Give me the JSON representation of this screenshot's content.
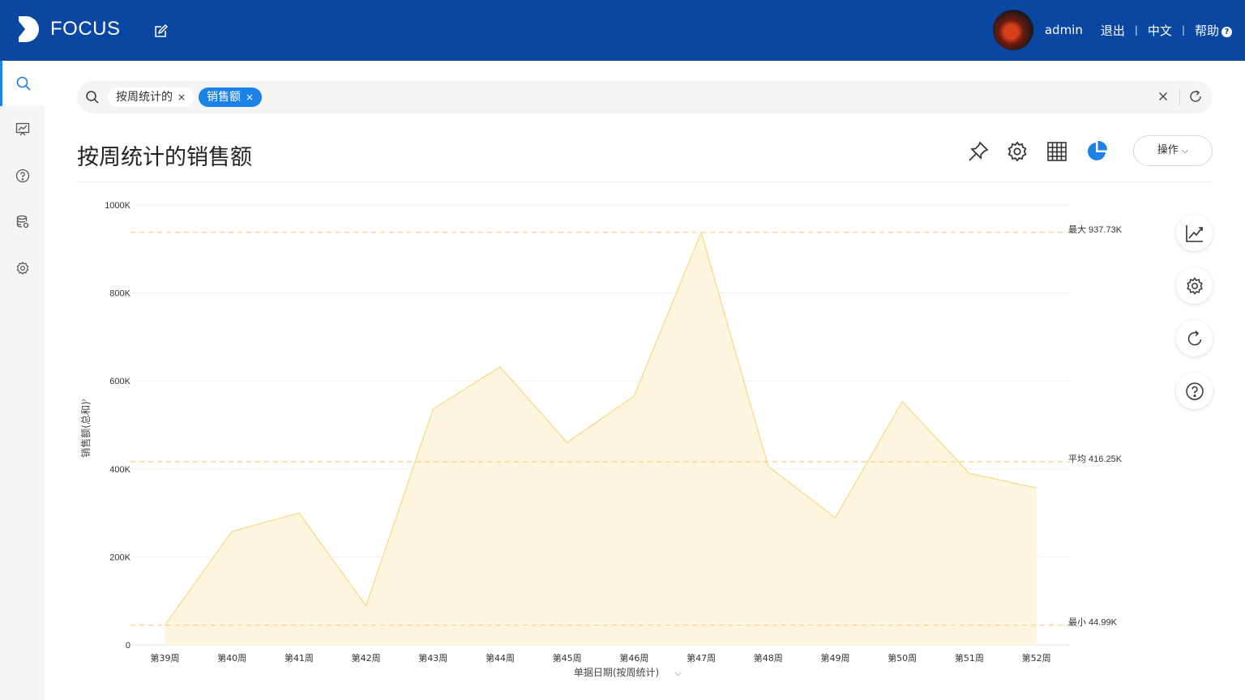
{
  "app": {
    "logo_text": "FOCUS"
  },
  "user": {
    "name": "admin",
    "logout": "退出",
    "language": "中文",
    "help": "帮助",
    "help_mark": "?"
  },
  "search": {
    "tokens": [
      {
        "label": "按周统计的",
        "selected": false,
        "remove": "×"
      },
      {
        "label": "销售额",
        "selected": true,
        "remove": "×"
      }
    ],
    "clear": "×"
  },
  "page": {
    "title": "按周统计的销售额",
    "operate_label": "操作",
    "operate_caret": "⌵"
  },
  "sidebar": {
    "items": [
      "search",
      "chart-board",
      "question",
      "data",
      "settings"
    ]
  },
  "colors": {
    "header": "#0a47a3",
    "accent": "#1a82e8",
    "line": "#f7d98a",
    "fill": "#fdf5de",
    "refline": "#f5cf79"
  },
  "chart_data": {
    "type": "area",
    "categories": [
      "第39周",
      "第40周",
      "第41周",
      "第42周",
      "第43周",
      "第44周",
      "第45周",
      "第46周",
      "第47周",
      "第48周",
      "第49周",
      "第50周",
      "第51周",
      "第52周"
    ],
    "values": [
      44990,
      258000,
      300000,
      89000,
      536000,
      632000,
      460000,
      566000,
      937730,
      406000,
      289000,
      553000,
      390000,
      357000
    ],
    "ylim": [
      0,
      1000000
    ],
    "yticks": [
      "0",
      "200K",
      "400K",
      "600K",
      "800K",
      "1000K"
    ],
    "ylabel": "销售额(总和)",
    "ylabel_caret": "›",
    "xlabel": "单据日期(按周统计)",
    "xlabel_caret": "⌵",
    "reference_lines": [
      {
        "label": "最大 937.73K",
        "value": 937730
      },
      {
        "label": "平均 416.25K",
        "value": 416250
      },
      {
        "label": "最小 44.99K",
        "value": 44990
      }
    ],
    "grid": true
  }
}
